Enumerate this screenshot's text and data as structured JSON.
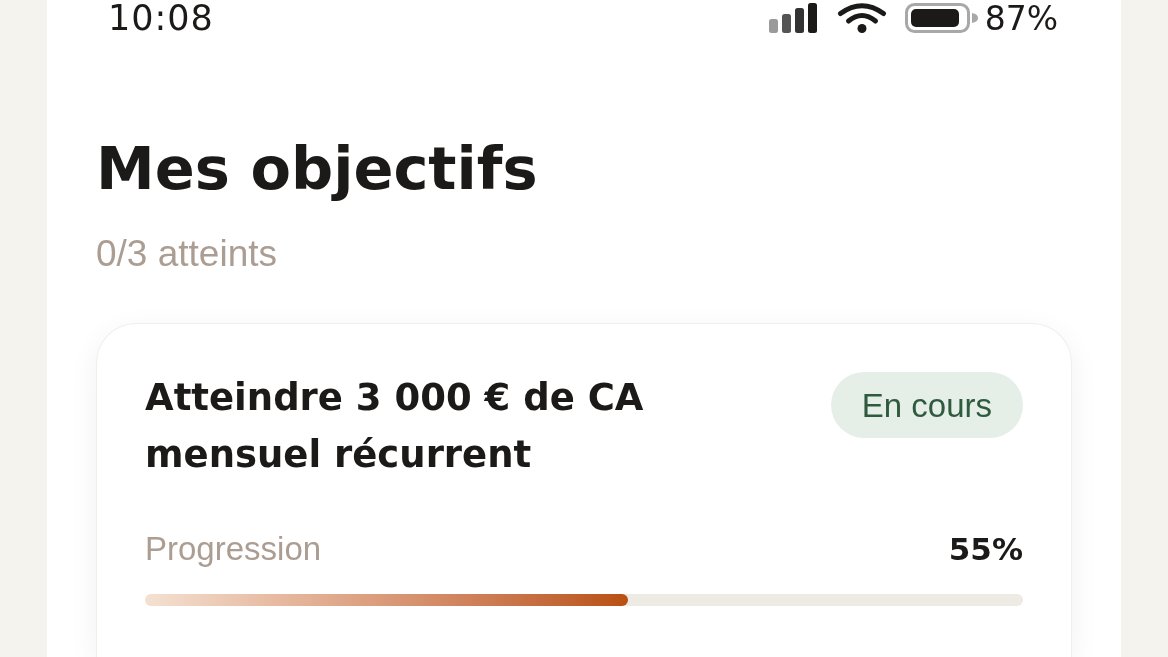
{
  "status_bar": {
    "time": "10:08",
    "battery": "87%"
  },
  "header": {
    "title": "Mes objectifs",
    "subtitle": "0/3 atteints"
  },
  "goals": [
    {
      "title": "Atteindre 3 000 € de CA mensuel récurrent",
      "status": {
        "label": "En cours",
        "kind": "in_progress"
      },
      "progress_label": "Progression",
      "progress_value": "55%",
      "level": 0.55
    }
  ]
}
